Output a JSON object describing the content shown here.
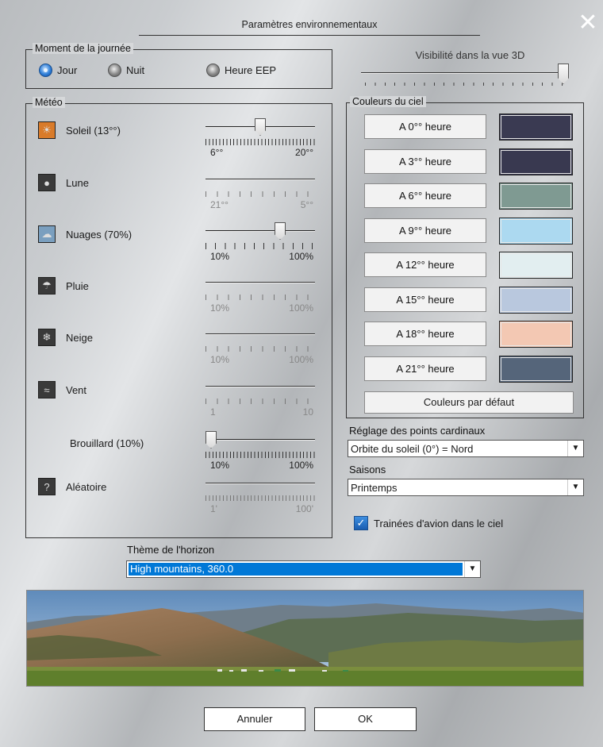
{
  "dialog": {
    "title": "Paramètres environnementaux",
    "close_glyph": "✕"
  },
  "moment": {
    "legend": "Moment de la journée",
    "options": [
      {
        "label": "Jour",
        "selected": true
      },
      {
        "label": "Nuit",
        "selected": false
      },
      {
        "label": "Heure EEP",
        "selected": false
      }
    ]
  },
  "visibility": {
    "label": "Visibilité dans la vue 3D",
    "value": 1.0
  },
  "meteo": {
    "legend": "Météo",
    "rows": [
      {
        "icon": "sun-icon",
        "label": "Soleil (13°°)",
        "min": "6°°",
        "max": "20°°",
        "enabled": true,
        "value": 0.5
      },
      {
        "icon": "moon-icon",
        "label": "Lune",
        "min": "21°°",
        "max": "5°°",
        "enabled": false
      },
      {
        "icon": "clouds-icon",
        "label": "Nuages (70%)",
        "min": "10%",
        "max": "100%",
        "enabled": true,
        "value": 0.7
      },
      {
        "icon": "rain-icon",
        "label": "Pluie",
        "min": "10%",
        "max": "100%",
        "enabled": false
      },
      {
        "icon": "snow-icon",
        "label": "Neige",
        "min": "10%",
        "max": "100%",
        "enabled": false
      },
      {
        "icon": "wind-icon",
        "label": "Vent",
        "min": "1",
        "max": "10",
        "enabled": false
      },
      {
        "icon": "",
        "label": "Brouillard (10%)",
        "min": "10%",
        "max": "100%",
        "enabled": true,
        "value": 0.0
      },
      {
        "icon": "random-icon",
        "label": "Aléatoire",
        "min": "1'",
        "max": "100'",
        "enabled": false
      }
    ]
  },
  "sky": {
    "legend": "Couleurs du ciel",
    "items": [
      {
        "label": "A 0°° heure",
        "color": "#3a3a52"
      },
      {
        "label": "A 3°° heure",
        "color": "#393950"
      },
      {
        "label": "A 6°° heure",
        "color": "#7f9a92"
      },
      {
        "label": "A 9°° heure",
        "color": "#acd9f0"
      },
      {
        "label": "A 12°° heure",
        "color": "#e2eef0"
      },
      {
        "label": "A 15°° heure",
        "color": "#b9c8de"
      },
      {
        "label": "A 18°° heure",
        "color": "#f3c8b3"
      },
      {
        "label": "A 21°° heure",
        "color": "#55657a"
      }
    ],
    "default_button": "Couleurs par défaut"
  },
  "cardinal": {
    "label": "Réglage des points cardinaux",
    "value": "Orbite du soleil (0°) = Nord"
  },
  "seasons": {
    "label": "Saisons",
    "value": "Printemps"
  },
  "contrails": {
    "label": "Trainées d'avion dans le ciel",
    "checked": true
  },
  "horizon": {
    "label": "Thème de l'horizon",
    "value": "High mountains, 360.0"
  },
  "buttons": {
    "cancel": "Annuler",
    "ok": "OK"
  }
}
